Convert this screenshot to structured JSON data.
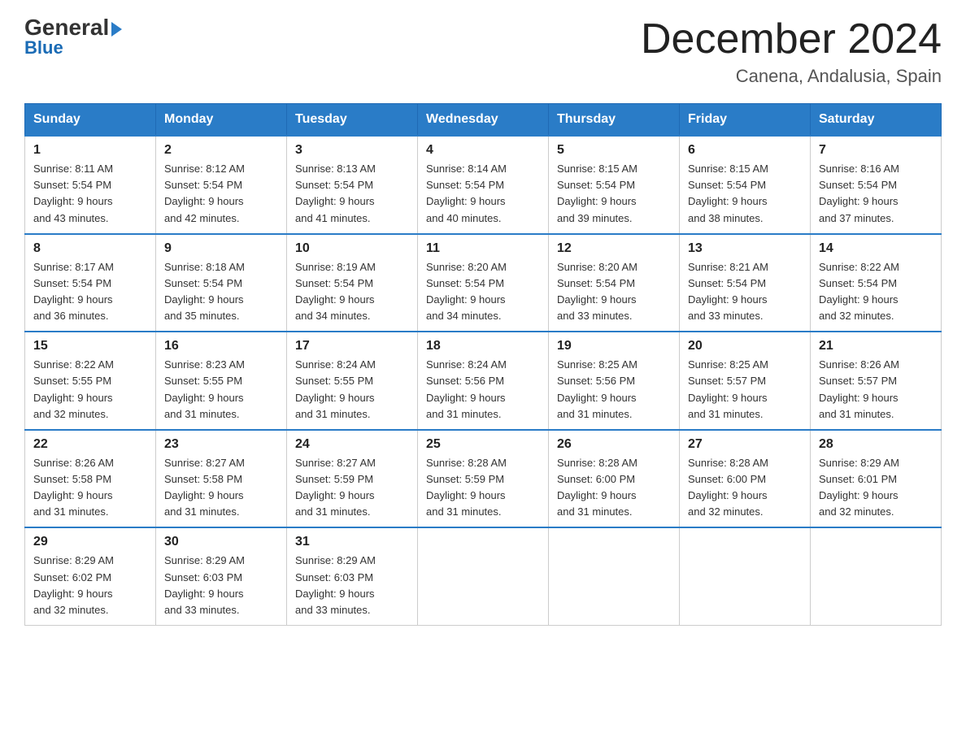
{
  "header": {
    "logo_general": "General",
    "logo_blue": "Blue",
    "month_year": "December 2024",
    "location": "Canena, Andalusia, Spain"
  },
  "weekdays": [
    "Sunday",
    "Monday",
    "Tuesday",
    "Wednesday",
    "Thursday",
    "Friday",
    "Saturday"
  ],
  "weeks": [
    [
      {
        "day": "1",
        "info": "Sunrise: 8:11 AM\nSunset: 5:54 PM\nDaylight: 9 hours\nand 43 minutes."
      },
      {
        "day": "2",
        "info": "Sunrise: 8:12 AM\nSunset: 5:54 PM\nDaylight: 9 hours\nand 42 minutes."
      },
      {
        "day": "3",
        "info": "Sunrise: 8:13 AM\nSunset: 5:54 PM\nDaylight: 9 hours\nand 41 minutes."
      },
      {
        "day": "4",
        "info": "Sunrise: 8:14 AM\nSunset: 5:54 PM\nDaylight: 9 hours\nand 40 minutes."
      },
      {
        "day": "5",
        "info": "Sunrise: 8:15 AM\nSunset: 5:54 PM\nDaylight: 9 hours\nand 39 minutes."
      },
      {
        "day": "6",
        "info": "Sunrise: 8:15 AM\nSunset: 5:54 PM\nDaylight: 9 hours\nand 38 minutes."
      },
      {
        "day": "7",
        "info": "Sunrise: 8:16 AM\nSunset: 5:54 PM\nDaylight: 9 hours\nand 37 minutes."
      }
    ],
    [
      {
        "day": "8",
        "info": "Sunrise: 8:17 AM\nSunset: 5:54 PM\nDaylight: 9 hours\nand 36 minutes."
      },
      {
        "day": "9",
        "info": "Sunrise: 8:18 AM\nSunset: 5:54 PM\nDaylight: 9 hours\nand 35 minutes."
      },
      {
        "day": "10",
        "info": "Sunrise: 8:19 AM\nSunset: 5:54 PM\nDaylight: 9 hours\nand 34 minutes."
      },
      {
        "day": "11",
        "info": "Sunrise: 8:20 AM\nSunset: 5:54 PM\nDaylight: 9 hours\nand 34 minutes."
      },
      {
        "day": "12",
        "info": "Sunrise: 8:20 AM\nSunset: 5:54 PM\nDaylight: 9 hours\nand 33 minutes."
      },
      {
        "day": "13",
        "info": "Sunrise: 8:21 AM\nSunset: 5:54 PM\nDaylight: 9 hours\nand 33 minutes."
      },
      {
        "day": "14",
        "info": "Sunrise: 8:22 AM\nSunset: 5:54 PM\nDaylight: 9 hours\nand 32 minutes."
      }
    ],
    [
      {
        "day": "15",
        "info": "Sunrise: 8:22 AM\nSunset: 5:55 PM\nDaylight: 9 hours\nand 32 minutes."
      },
      {
        "day": "16",
        "info": "Sunrise: 8:23 AM\nSunset: 5:55 PM\nDaylight: 9 hours\nand 31 minutes."
      },
      {
        "day": "17",
        "info": "Sunrise: 8:24 AM\nSunset: 5:55 PM\nDaylight: 9 hours\nand 31 minutes."
      },
      {
        "day": "18",
        "info": "Sunrise: 8:24 AM\nSunset: 5:56 PM\nDaylight: 9 hours\nand 31 minutes."
      },
      {
        "day": "19",
        "info": "Sunrise: 8:25 AM\nSunset: 5:56 PM\nDaylight: 9 hours\nand 31 minutes."
      },
      {
        "day": "20",
        "info": "Sunrise: 8:25 AM\nSunset: 5:57 PM\nDaylight: 9 hours\nand 31 minutes."
      },
      {
        "day": "21",
        "info": "Sunrise: 8:26 AM\nSunset: 5:57 PM\nDaylight: 9 hours\nand 31 minutes."
      }
    ],
    [
      {
        "day": "22",
        "info": "Sunrise: 8:26 AM\nSunset: 5:58 PM\nDaylight: 9 hours\nand 31 minutes."
      },
      {
        "day": "23",
        "info": "Sunrise: 8:27 AM\nSunset: 5:58 PM\nDaylight: 9 hours\nand 31 minutes."
      },
      {
        "day": "24",
        "info": "Sunrise: 8:27 AM\nSunset: 5:59 PM\nDaylight: 9 hours\nand 31 minutes."
      },
      {
        "day": "25",
        "info": "Sunrise: 8:28 AM\nSunset: 5:59 PM\nDaylight: 9 hours\nand 31 minutes."
      },
      {
        "day": "26",
        "info": "Sunrise: 8:28 AM\nSunset: 6:00 PM\nDaylight: 9 hours\nand 31 minutes."
      },
      {
        "day": "27",
        "info": "Sunrise: 8:28 AM\nSunset: 6:00 PM\nDaylight: 9 hours\nand 32 minutes."
      },
      {
        "day": "28",
        "info": "Sunrise: 8:29 AM\nSunset: 6:01 PM\nDaylight: 9 hours\nand 32 minutes."
      }
    ],
    [
      {
        "day": "29",
        "info": "Sunrise: 8:29 AM\nSunset: 6:02 PM\nDaylight: 9 hours\nand 32 minutes."
      },
      {
        "day": "30",
        "info": "Sunrise: 8:29 AM\nSunset: 6:03 PM\nDaylight: 9 hours\nand 33 minutes."
      },
      {
        "day": "31",
        "info": "Sunrise: 8:29 AM\nSunset: 6:03 PM\nDaylight: 9 hours\nand 33 minutes."
      },
      null,
      null,
      null,
      null
    ]
  ]
}
